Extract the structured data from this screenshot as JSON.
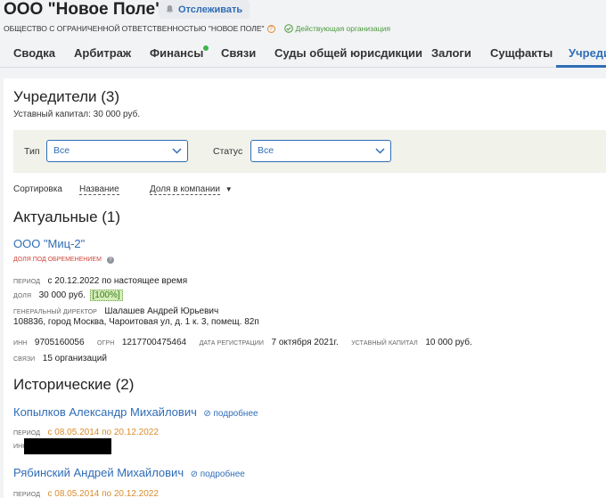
{
  "header": {
    "company_title": "ООО \"Новое Поле\"",
    "track_label": "Отслеживать",
    "full_name": "ОБЩЕСТВО С ОГРАНИЧЕННОЙ ОТВЕТСТВЕННОСТЬЮ \"НОВОЕ ПОЛЕ\"",
    "status": "Действующая организация"
  },
  "tabs": [
    {
      "label": "Сводка"
    },
    {
      "label": "Арбитраж"
    },
    {
      "label": "Финансы"
    },
    {
      "label": "Связи"
    },
    {
      "label": "Суды общей юрисдикции"
    },
    {
      "label": "Залоги"
    },
    {
      "label": "Сущфакты"
    },
    {
      "label": "Учреди"
    }
  ],
  "colors": {
    "accent": "#2f6db7",
    "status_green": "#4a9a3a",
    "alert_red": "#d0453a",
    "period_orange": "#d98b2b"
  },
  "section": {
    "title": "Учредители (3)",
    "capital": "Уставный капитал: 30 000 руб."
  },
  "filters": {
    "type_label": "Тип",
    "type_value": "Все",
    "status_label": "Статус",
    "status_value": "Все"
  },
  "sort": {
    "label": "Сортировка",
    "by_name": "Название",
    "by_share": "Доля в компании"
  },
  "current": {
    "heading": "Актуальные (1)",
    "name": "ООО \"Миц-2\"",
    "encumbrance": "ДОЛЯ ПОД ОБРЕМЕНЕНИЕМ",
    "period_label": "ПЕРИОД",
    "period_value": "с 20.12.2022 по настоящее время",
    "share_label": "ДОЛЯ",
    "share_value": "30 000 руб.",
    "share_percent": "[100%]",
    "director_label": "ГЕНЕРАЛЬНЫЙ ДИРЕКТОР",
    "director_value": "Шалашев Андрей Юрьевич",
    "address": "108836, город Москва, Чароитовая ул, д. 1 к. 3, помещ. 82п",
    "inn_label": "ИНН",
    "inn_value": "9705160056",
    "ogrn_label": "ОГРН",
    "ogrn_value": "1217700475464",
    "regdate_label": "ДАТА РЕГИСТРАЦИИ",
    "regdate_value": "7 октября 2021г.",
    "capital_label": "УСТАВНЫЙ КАПИТАЛ",
    "capital_value": "10 000 руб.",
    "links_label": "СВЯЗИ",
    "links_value": "15 организаций"
  },
  "historical": {
    "heading": "Исторические (2)",
    "items": [
      {
        "name": "Копылков Александр Михайлович",
        "more": "подробнее",
        "period_label": "ПЕРИОД",
        "period_value": "с 08.05.2014 по 20.12.2022",
        "inn_label": "ИНН"
      },
      {
        "name": "Рябинский Андрей Михайлович",
        "more": "подробнее",
        "period_label": "ПЕРИОД",
        "period_value": "с 08.05.2014 по 20.12.2022"
      }
    ]
  }
}
